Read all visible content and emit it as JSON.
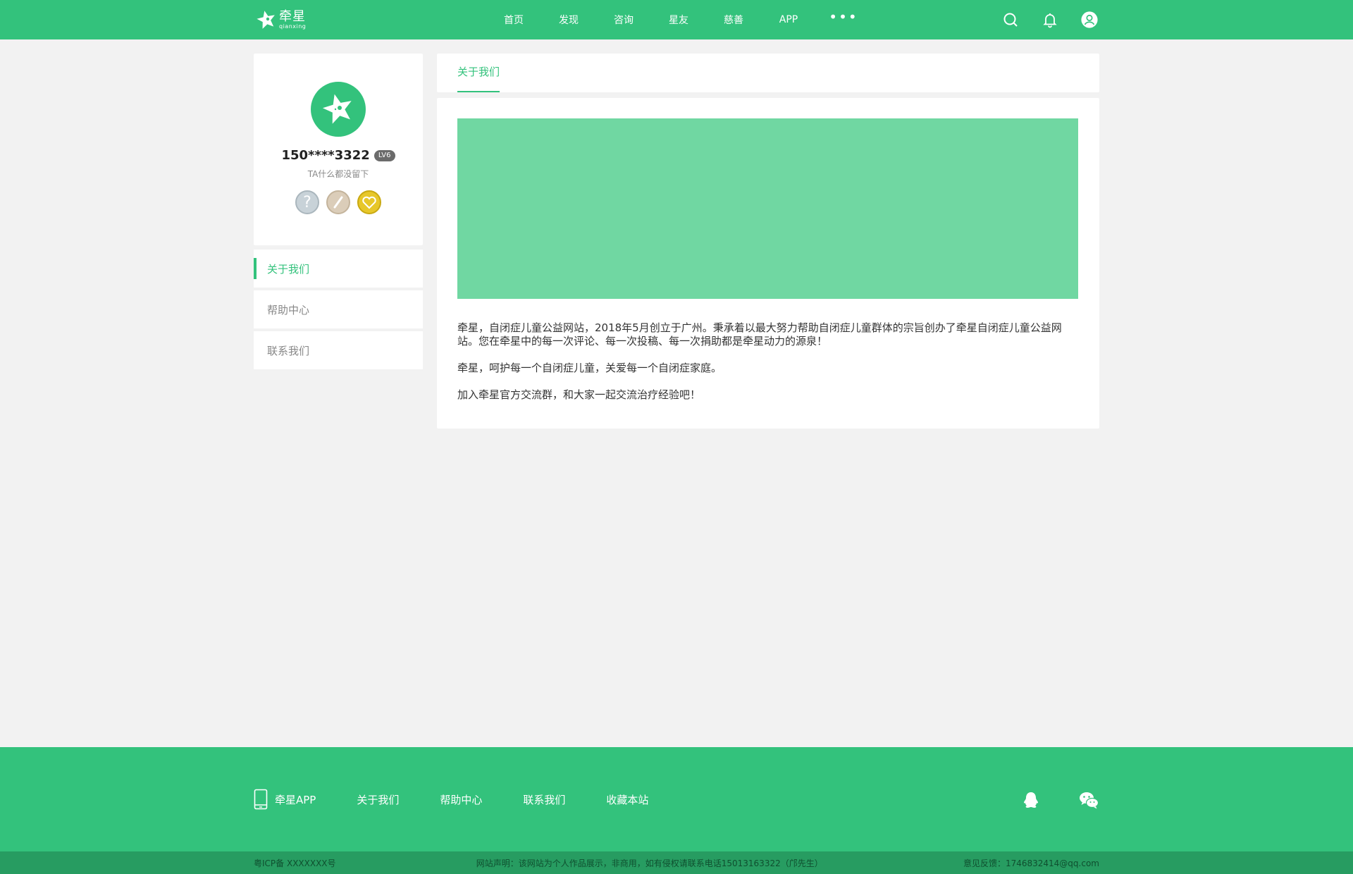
{
  "brand": {
    "name_cn": "牵星",
    "name_en": "qianxing",
    "primary_color": "#33c27c",
    "banner_color": "#70d7a2"
  },
  "nav": {
    "items": [
      {
        "label": "首页"
      },
      {
        "label": "发现"
      },
      {
        "label": "咨询"
      },
      {
        "label": "星友"
      },
      {
        "label": "慈善"
      },
      {
        "label": "APP"
      }
    ],
    "more_label": "•••"
  },
  "header_icons": [
    "search-icon",
    "bell-icon",
    "user-icon"
  ],
  "profile": {
    "username": "150****3322",
    "level": "LV6",
    "signature": "TA什么都没留下",
    "medals": [
      "question-medal-icon",
      "pen-medal-icon",
      "heart-medal-icon"
    ]
  },
  "side_menu": {
    "items": [
      {
        "label": "关于我们",
        "active": true
      },
      {
        "label": "帮助中心",
        "active": false
      },
      {
        "label": "联系我们",
        "active": false
      }
    ]
  },
  "main": {
    "tab_label": "关于我们",
    "paragraphs": [
      "牵星，自闭症儿童公益网站，2018年5月创立于广州。秉承着以最大努力帮助自闭症儿童群体的宗旨创办了牵星自闭症儿童公益网站。您在牵星中的每一次评论、每一次投稿、每一次捐助都是牵星动力的源泉！",
      "牵星，呵护每一个自闭症儿童，关爱每一个自闭症家庭。",
      "加入牵星官方交流群，和大家一起交流治疗经验吧！"
    ]
  },
  "footer": {
    "links": [
      {
        "label": "牵星APP"
      },
      {
        "label": "关于我们"
      },
      {
        "label": "帮助中心"
      },
      {
        "label": "联系我们"
      },
      {
        "label": "收藏本站"
      }
    ],
    "social": [
      "qq-icon",
      "wechat-icon"
    ],
    "icp": "粤ICP备 XXXXXXX号",
    "statement": "网站声明：该网站为个人作品展示，非商用，如有侵权请联系电话15013163322（邝先生）",
    "feedback": "意见反馈：1746832414@qq.com"
  }
}
